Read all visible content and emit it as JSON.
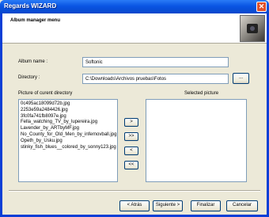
{
  "window": {
    "title": "Regards WIZARD"
  },
  "header": {
    "title": "Album manager menu"
  },
  "form": {
    "album_name_label": "Album name :",
    "album_name_value": "Softonic",
    "directory_label": "Directory :",
    "directory_value": "C:\\Downloads\\Archivos pruebas\\Fotos",
    "browse_label": "..."
  },
  "lists": {
    "current_directory_label": "Picture of curent directory",
    "selected_label": "Selected picture",
    "files": [
      "0c495ac18099d72b.jpg",
      "2253e59a2484426.jpg",
      "3fc0fa741fb8097e.jpg",
      "Fella_watching_TV_by_lupereira.jpg",
      "Lavender_by_ARTbyMF.jpg",
      "No_County_for_Old_Men_by_infernovball.jpg",
      "Opeth_by_Usku.jpg",
      "stinky_fish_blues__colored_by_sonny123.jpg"
    ],
    "selected": []
  },
  "transfer_buttons": {
    "add_one": ">",
    "add_all": ">>",
    "remove_one": "<",
    "remove_all": "<<"
  },
  "footer": {
    "back_label": "< Atrás",
    "next_label": "Siguiente >",
    "finish_label": "Finalizar",
    "cancel_label": "Cancelar"
  }
}
